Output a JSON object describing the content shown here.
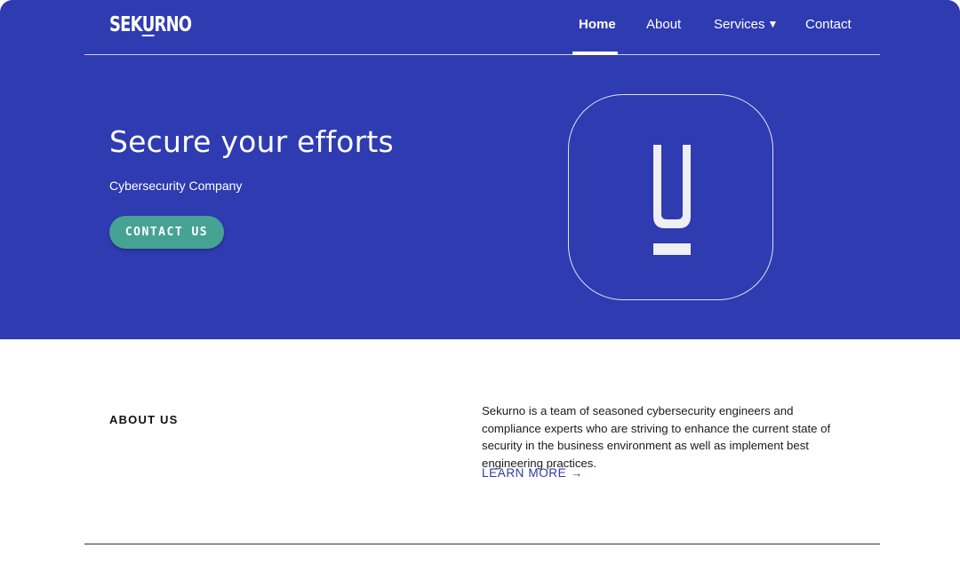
{
  "brand": {
    "logo_text_a": "SEK",
    "logo_text_b": "U",
    "logo_text_c": "RNO"
  },
  "nav": {
    "items": [
      {
        "label": "Home",
        "active": true
      },
      {
        "label": "About",
        "active": false
      },
      {
        "label": "Services",
        "active": false
      },
      {
        "label": "Contact",
        "active": false
      }
    ],
    "dropdown_caret": "▼"
  },
  "hero": {
    "title": "Secure your efforts",
    "subtitle": "Cybersecurity Company",
    "cta_label": "CONTACT US",
    "badge_icon": "sekurno-u-mark-icon"
  },
  "about": {
    "heading": "ABOUT US",
    "body": "Sekurno is a team of seasoned cybersecurity engineers and compliance experts who are striving to enhance the current state of security in the business environment as well as implement best engineering practices.",
    "learn_more_label": "LEARN MORE →"
  },
  "colors": {
    "hero_background": "#2f3bb1",
    "cta_background": "#46a393",
    "link": "#2f3a9e"
  }
}
